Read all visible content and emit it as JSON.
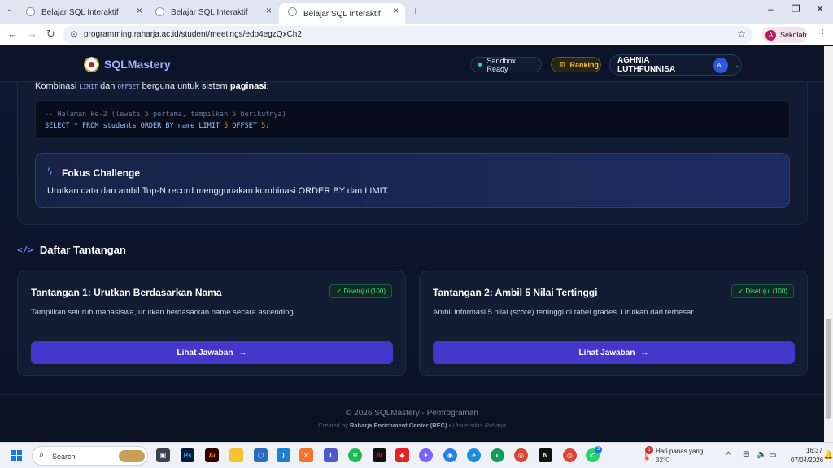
{
  "browser": {
    "tabs": [
      {
        "title": "Belajar SQL Interaktif"
      },
      {
        "title": "Belajar SQL Interaktif"
      },
      {
        "title": "Belajar SQL Interaktif"
      }
    ],
    "new_tab": "+",
    "url": "programming.raharja.ac.id/student/meetings/edp4egzQxCh2",
    "profile_label": "Sekolah",
    "profile_initial": "A"
  },
  "app": {
    "brand": "SQLMastery",
    "status_pill": "Sandbox Ready",
    "ranking_label": "Ranking",
    "user_name": "AGHNIA LUTHFUNNISA",
    "user_initials": "AL",
    "accent_color": "#4338ca",
    "status_color": "#34d399"
  },
  "lesson": {
    "intro_prefix": "Kombinasi",
    "intro_code1": "LIMIT",
    "intro_mid": "dan",
    "intro_code2": "OFFSET",
    "intro_suffix": "berguna untuk sistem",
    "intro_bold": "paginasi",
    "intro_end": ":",
    "code_comment": "-- Halaman ke-2 (lewati 5 pertama, tampilkan 5 berikutnya)",
    "code_sql_part1": "SELECT * FROM students ORDER BY name LIMIT ",
    "code_num1": "5",
    "code_sql_part2": " OFFSET ",
    "code_num2": "5",
    "code_sql_end": ";",
    "focus_title": "Fokus Challenge",
    "focus_text": "Urutkan data dan ambil Top-N record menggunakan kombinasi ORDER BY dan LIMIT."
  },
  "challenges_section": {
    "title": "Daftar Tantangan",
    "icon": "code-icon",
    "items": [
      {
        "title": "Tantangan 1: Urutkan Berdasarkan Nama",
        "badge": "✓ Disetujui (100)",
        "description": "Tampilkan seluruh mahasiswa, urutkan berdasarkan name secara ascending.",
        "button": "Lihat Jawaban"
      },
      {
        "title": "Tantangan 2: Ambil 5 Nilai Tertinggi",
        "badge": "✓ Disetujui (100)",
        "description": "Ambil informasi 5 nilai (score) tertinggi di tabel grades. Urutkan dari terbesar.",
        "button": "Lihat Jawaban"
      }
    ]
  },
  "footer": {
    "copyright": "© 2026 SQLMastery - Pemrograman",
    "created_by": "Created by",
    "org": "Raharja Enrichment Center (REC)",
    "separator": "•",
    "university": "Universitas Raharja"
  },
  "taskbar": {
    "search_placeholder": "Search",
    "weather_text": "Hari panas yang...",
    "temperature": "32°C",
    "weather_badge": "1",
    "time": "16:37",
    "date": "07/04/2026",
    "whatsapp_badge": "3",
    "icons": [
      "file-explorer-icon",
      "photoshop-icon",
      "illustrator-icon",
      "folder-icon",
      "virtualbox-icon",
      "vscode-icon",
      "xampp-icon",
      "teams-icon",
      "spotify-icon",
      "netflix-icon",
      "copilot-icon",
      "edge-icon",
      "chrome-icon",
      "notion-icon",
      "chrome-profile-icon",
      "whatsapp-icon"
    ]
  }
}
